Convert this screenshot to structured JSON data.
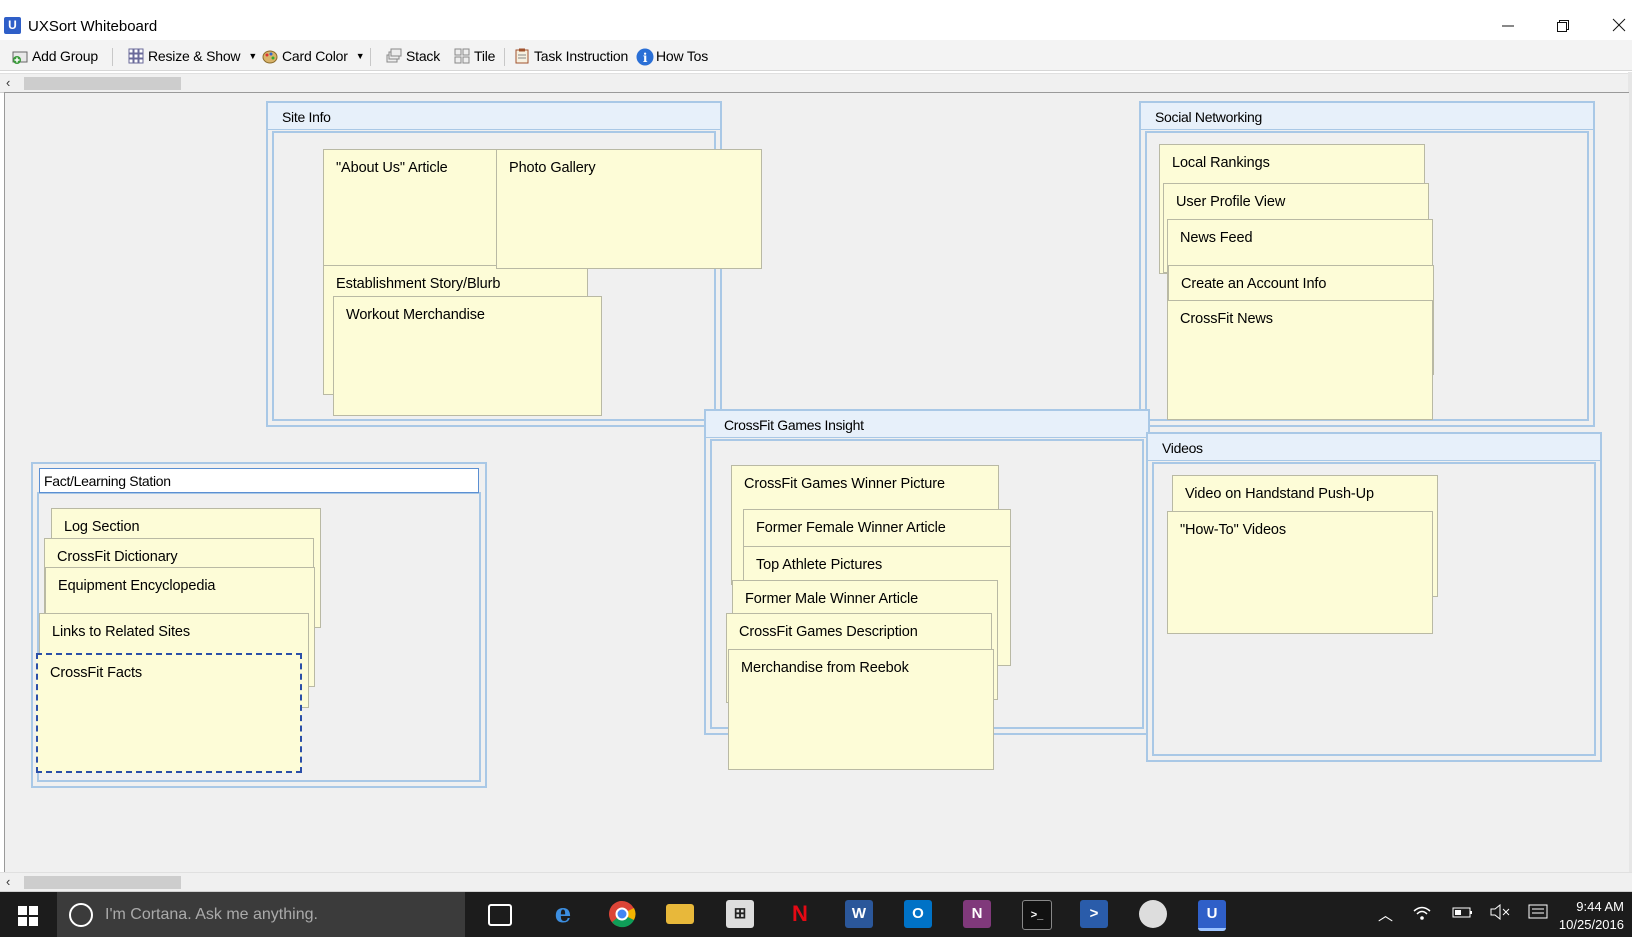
{
  "window": {
    "title": "UXSort Whiteboard",
    "app_icon_letter": "U",
    "controls": [
      "minimize-icon",
      "restore-icon",
      "close-icon"
    ]
  },
  "toolbar": {
    "add_group": "Add Group",
    "resize_show": "Resize & Show",
    "card_color": "Card Color",
    "stack": "Stack",
    "tile": "Tile",
    "task_instruction": "Task Instruction",
    "how_tos": "How Tos"
  },
  "groups": {
    "site_info": {
      "title": "Site Info",
      "cards": [
        "\"About Us\" Article",
        "Photo Gallery",
        "Establishment Story/Blurb",
        "Workout Merchandise"
      ]
    },
    "social_networking": {
      "title": "Social Networking",
      "cards": [
        "Local Rankings",
        "User Profile View",
        "News Feed",
        "Create an Account Info",
        "CrossFit News"
      ]
    },
    "crossfit_games": {
      "title": "CrossFit Games Insight",
      "cards": [
        "CrossFit Games Winner Picture",
        "Former Female Winner Article",
        "Top Athlete Pictures",
        "Former Male Winner Article",
        "CrossFit Games Description",
        "Merchandise from Reebok"
      ]
    },
    "videos": {
      "title": "Videos",
      "cards": [
        "Video on Handstand Push-Up",
        "\"How-To\" Videos"
      ]
    },
    "fact_learning": {
      "title": "Fact/Learning Station",
      "cards": [
        "Log Section",
        "CrossFit Dictionary",
        "Equipment Encyclopedia",
        "Links to Related Sites",
        "CrossFit Facts"
      ]
    }
  },
  "taskbar": {
    "search_placeholder": "I'm Cortana. Ask me anything.",
    "time": "9:44 AM",
    "date": "10/25/2016",
    "apps": [
      "task-view-icon",
      "edge-icon",
      "chrome-icon",
      "file-explorer-icon",
      "store-icon",
      "netflix-icon",
      "word-icon",
      "outlook-icon",
      "onenote-icon",
      "terminal-icon",
      "powershell-icon",
      "clock-app-icon",
      "uxsort-icon"
    ]
  },
  "colors": {
    "card": "#fdfcd7",
    "group_border": "#a9c8e6",
    "canvas": "#f0f0f0",
    "taskbar": "#1c1c1c"
  }
}
